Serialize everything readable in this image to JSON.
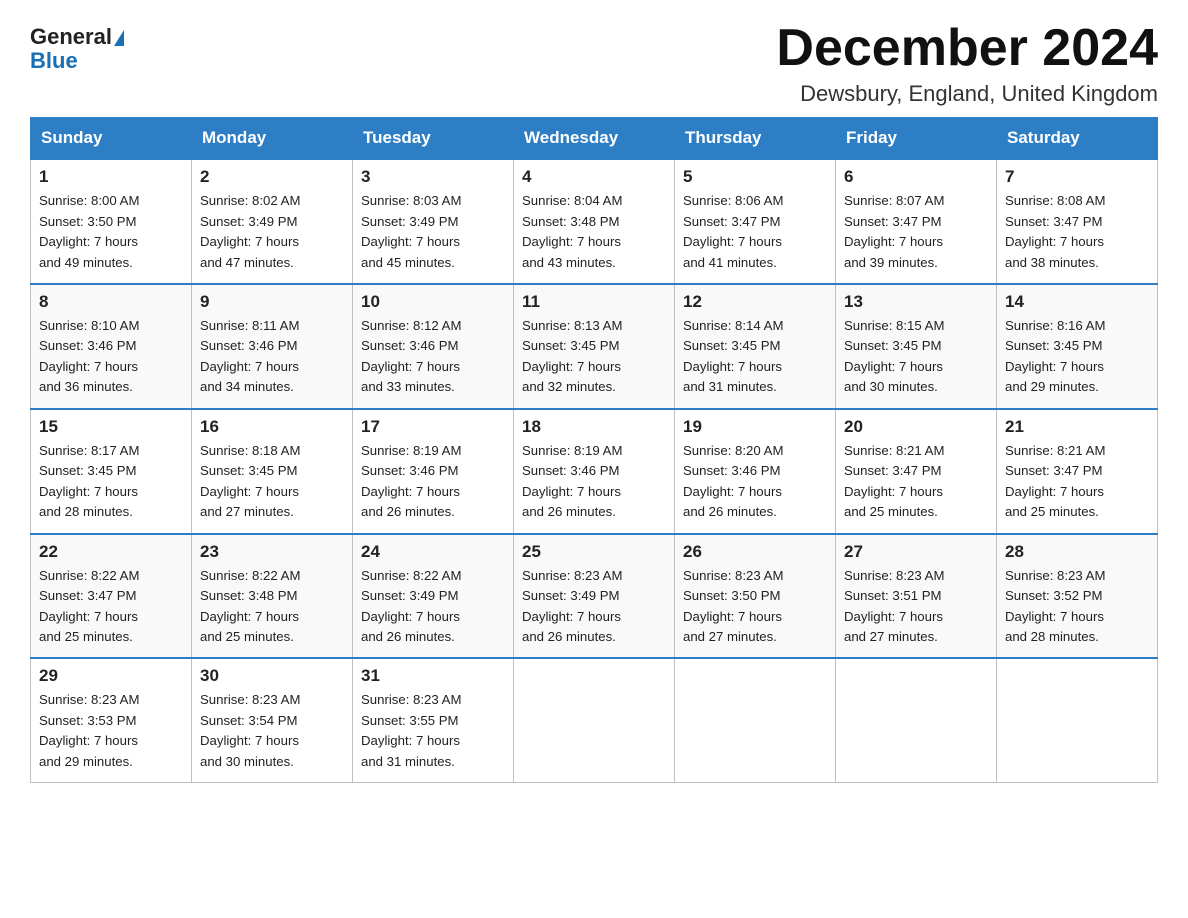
{
  "header": {
    "logo_line1": "General",
    "logo_line2": "Blue",
    "title": "December 2024",
    "subtitle": "Dewsbury, England, United Kingdom"
  },
  "columns": [
    "Sunday",
    "Monday",
    "Tuesday",
    "Wednesday",
    "Thursday",
    "Friday",
    "Saturday"
  ],
  "weeks": [
    [
      {
        "day": "1",
        "sunrise": "8:00 AM",
        "sunset": "3:50 PM",
        "daylight": "7 hours and 49 minutes."
      },
      {
        "day": "2",
        "sunrise": "8:02 AM",
        "sunset": "3:49 PM",
        "daylight": "7 hours and 47 minutes."
      },
      {
        "day": "3",
        "sunrise": "8:03 AM",
        "sunset": "3:49 PM",
        "daylight": "7 hours and 45 minutes."
      },
      {
        "day": "4",
        "sunrise": "8:04 AM",
        "sunset": "3:48 PM",
        "daylight": "7 hours and 43 minutes."
      },
      {
        "day": "5",
        "sunrise": "8:06 AM",
        "sunset": "3:47 PM",
        "daylight": "7 hours and 41 minutes."
      },
      {
        "day": "6",
        "sunrise": "8:07 AM",
        "sunset": "3:47 PM",
        "daylight": "7 hours and 39 minutes."
      },
      {
        "day": "7",
        "sunrise": "8:08 AM",
        "sunset": "3:47 PM",
        "daylight": "7 hours and 38 minutes."
      }
    ],
    [
      {
        "day": "8",
        "sunrise": "8:10 AM",
        "sunset": "3:46 PM",
        "daylight": "7 hours and 36 minutes."
      },
      {
        "day": "9",
        "sunrise": "8:11 AM",
        "sunset": "3:46 PM",
        "daylight": "7 hours and 34 minutes."
      },
      {
        "day": "10",
        "sunrise": "8:12 AM",
        "sunset": "3:46 PM",
        "daylight": "7 hours and 33 minutes."
      },
      {
        "day": "11",
        "sunrise": "8:13 AM",
        "sunset": "3:45 PM",
        "daylight": "7 hours and 32 minutes."
      },
      {
        "day": "12",
        "sunrise": "8:14 AM",
        "sunset": "3:45 PM",
        "daylight": "7 hours and 31 minutes."
      },
      {
        "day": "13",
        "sunrise": "8:15 AM",
        "sunset": "3:45 PM",
        "daylight": "7 hours and 30 minutes."
      },
      {
        "day": "14",
        "sunrise": "8:16 AM",
        "sunset": "3:45 PM",
        "daylight": "7 hours and 29 minutes."
      }
    ],
    [
      {
        "day": "15",
        "sunrise": "8:17 AM",
        "sunset": "3:45 PM",
        "daylight": "7 hours and 28 minutes."
      },
      {
        "day": "16",
        "sunrise": "8:18 AM",
        "sunset": "3:45 PM",
        "daylight": "7 hours and 27 minutes."
      },
      {
        "day": "17",
        "sunrise": "8:19 AM",
        "sunset": "3:46 PM",
        "daylight": "7 hours and 26 minutes."
      },
      {
        "day": "18",
        "sunrise": "8:19 AM",
        "sunset": "3:46 PM",
        "daylight": "7 hours and 26 minutes."
      },
      {
        "day": "19",
        "sunrise": "8:20 AM",
        "sunset": "3:46 PM",
        "daylight": "7 hours and 26 minutes."
      },
      {
        "day": "20",
        "sunrise": "8:21 AM",
        "sunset": "3:47 PM",
        "daylight": "7 hours and 25 minutes."
      },
      {
        "day": "21",
        "sunrise": "8:21 AM",
        "sunset": "3:47 PM",
        "daylight": "7 hours and 25 minutes."
      }
    ],
    [
      {
        "day": "22",
        "sunrise": "8:22 AM",
        "sunset": "3:47 PM",
        "daylight": "7 hours and 25 minutes."
      },
      {
        "day": "23",
        "sunrise": "8:22 AM",
        "sunset": "3:48 PM",
        "daylight": "7 hours and 25 minutes."
      },
      {
        "day": "24",
        "sunrise": "8:22 AM",
        "sunset": "3:49 PM",
        "daylight": "7 hours and 26 minutes."
      },
      {
        "day": "25",
        "sunrise": "8:23 AM",
        "sunset": "3:49 PM",
        "daylight": "7 hours and 26 minutes."
      },
      {
        "day": "26",
        "sunrise": "8:23 AM",
        "sunset": "3:50 PM",
        "daylight": "7 hours and 27 minutes."
      },
      {
        "day": "27",
        "sunrise": "8:23 AM",
        "sunset": "3:51 PM",
        "daylight": "7 hours and 27 minutes."
      },
      {
        "day": "28",
        "sunrise": "8:23 AM",
        "sunset": "3:52 PM",
        "daylight": "7 hours and 28 minutes."
      }
    ],
    [
      {
        "day": "29",
        "sunrise": "8:23 AM",
        "sunset": "3:53 PM",
        "daylight": "7 hours and 29 minutes."
      },
      {
        "day": "30",
        "sunrise": "8:23 AM",
        "sunset": "3:54 PM",
        "daylight": "7 hours and 30 minutes."
      },
      {
        "day": "31",
        "sunrise": "8:23 AM",
        "sunset": "3:55 PM",
        "daylight": "7 hours and 31 minutes."
      },
      null,
      null,
      null,
      null
    ]
  ],
  "labels": {
    "sunrise_prefix": "Sunrise: ",
    "sunset_prefix": "Sunset: ",
    "daylight_prefix": "Daylight: "
  }
}
